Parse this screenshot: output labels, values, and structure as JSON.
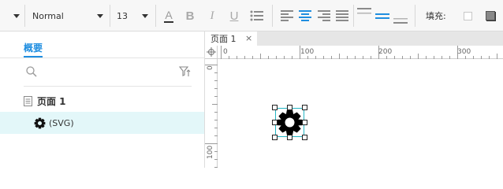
{
  "toolbar": {
    "font_family_value": "Normal",
    "font_size_value": "13",
    "format_buttons": [
      "A",
      "B",
      "I",
      "U"
    ],
    "fill_label": "填充:"
  },
  "left_panel": {
    "tab_label": "概要",
    "tree": [
      {
        "label": "页面 1",
        "type": "page",
        "selected": false
      },
      {
        "label": "(SVG)",
        "type": "svg",
        "selected": true
      }
    ]
  },
  "canvas": {
    "tab_label": "页面 1",
    "ruler_h_labels": [
      "0",
      "100",
      "200",
      "300"
    ],
    "ruler_v_labels": [
      "0",
      "100"
    ]
  },
  "colors": {
    "accent": "#1f8ee0",
    "selection_row": "#e3f7f9",
    "selection_box": "#24b5c4"
  }
}
